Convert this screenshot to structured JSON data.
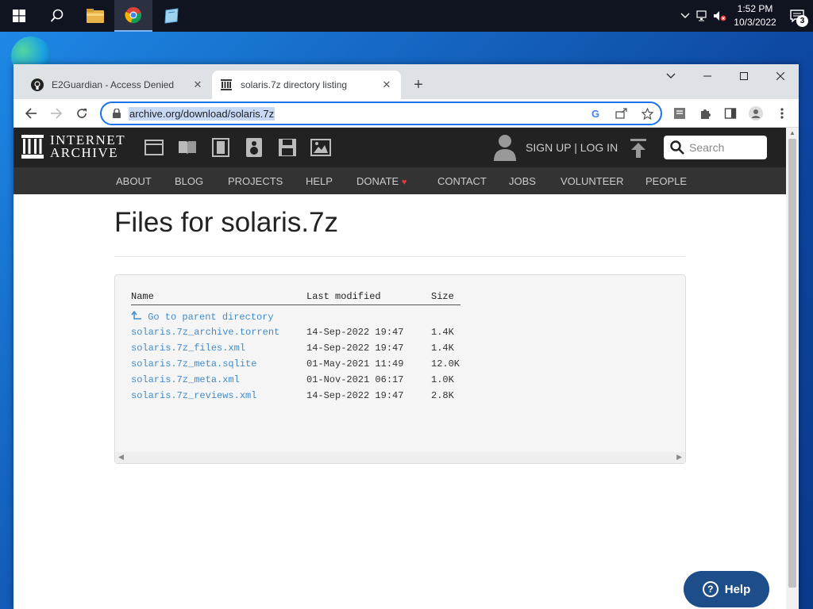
{
  "taskbar": {
    "clock_time": "1:52 PM",
    "clock_date": "10/3/2022",
    "notification_count": "3"
  },
  "browser": {
    "tabs": [
      {
        "title": "E2Guardian - Access Denied",
        "favicon": "github-icon",
        "active": false
      },
      {
        "title": "solaris.7z directory listing",
        "favicon": "archive-icon",
        "active": true
      }
    ],
    "url": "archive.org/download/solaris.7z"
  },
  "ia": {
    "logo_line1": "INTERNET",
    "logo_line2": "ARCHIVE",
    "signup_label": "SIGN UP | LOG IN",
    "search_placeholder": "Search",
    "nav": [
      "ABOUT",
      "BLOG",
      "PROJECTS",
      "HELP",
      "DONATE",
      "CONTACT",
      "JOBS",
      "VOLUNTEER",
      "PEOPLE"
    ],
    "donate_heart": "♥"
  },
  "page": {
    "title": "Files for solaris.7z",
    "columns": {
      "name": "Name",
      "modified": "Last modified",
      "size": "Size"
    },
    "parent_link": "Go to parent directory",
    "files": [
      {
        "name": "solaris.7z_archive.torrent",
        "modified": "14-Sep-2022 19:47",
        "size": "1.4K"
      },
      {
        "name": "solaris.7z_files.xml",
        "modified": "14-Sep-2022 19:47",
        "size": "1.4K"
      },
      {
        "name": "solaris.7z_meta.sqlite",
        "modified": "01-May-2021 11:49",
        "size": "12.0K"
      },
      {
        "name": "solaris.7z_meta.xml",
        "modified": "01-Nov-2021 06:17",
        "size": "1.0K"
      },
      {
        "name": "solaris.7z_reviews.xml",
        "modified": "14-Sep-2022 19:47",
        "size": "2.8K"
      }
    ],
    "help_label": "Help"
  },
  "colors": {
    "link": "#428bca",
    "ia_header": "#222222",
    "ia_nav": "#333333",
    "help_button": "#1d4e89",
    "omnibox_border": "#1a73e8"
  }
}
